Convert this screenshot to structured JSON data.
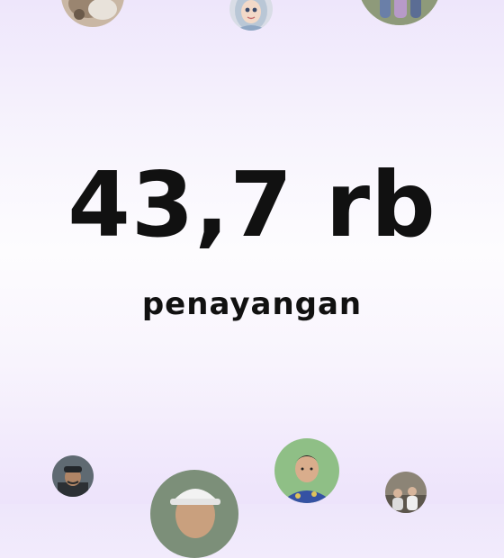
{
  "stats": {
    "view_count": "43,7 rb",
    "view_label": "penayangan"
  },
  "colors": {
    "text": "#111111",
    "background_top": "#eee6fb",
    "background_mid": "#fdfcfe"
  },
  "avatars": [
    {
      "name": "avatar-cat-photo"
    },
    {
      "name": "avatar-hijab-cartoon"
    },
    {
      "name": "avatar-outdoor-group"
    },
    {
      "name": "avatar-man-cap"
    },
    {
      "name": "avatar-man-white-cap"
    },
    {
      "name": "avatar-man-batik"
    },
    {
      "name": "avatar-small-group"
    }
  ]
}
